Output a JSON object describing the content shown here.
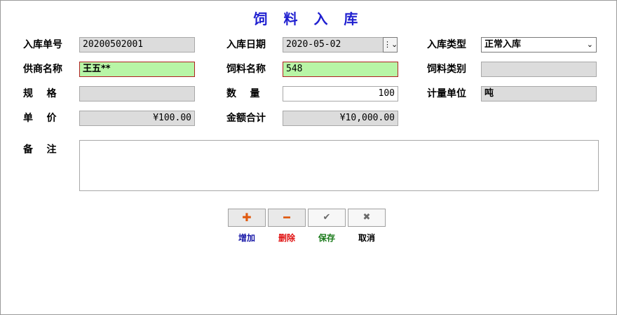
{
  "title": "饲 料 入 库",
  "fields": {
    "receipt_no": {
      "label": "入库单号",
      "value": "20200502001"
    },
    "receipt_date": {
      "label": "入库日期",
      "value": "2020-05-02"
    },
    "receipt_type": {
      "label": "入库类型",
      "value": "正常入库"
    },
    "supplier": {
      "label": "供商名称",
      "value": "王五**"
    },
    "feed_name": {
      "label": "饲料名称",
      "value": "548"
    },
    "feed_category": {
      "label": "饲料类别",
      "value": ""
    },
    "spec": {
      "label": "规    格",
      "value": ""
    },
    "quantity": {
      "label": "数    量",
      "value": "100"
    },
    "unit": {
      "label": "计量单位",
      "value": "吨"
    },
    "price": {
      "label": "单    价",
      "value": "¥100.00"
    },
    "amount": {
      "label": "金额合计",
      "value": "¥10,000.00"
    },
    "remark": {
      "label": "备    注",
      "value": ""
    }
  },
  "buttons": {
    "add": {
      "label": "增加",
      "icon": "plus-icon",
      "color": "#1a1aa8"
    },
    "delete": {
      "label": "删除",
      "icon": "minus-icon",
      "color": "#e01010"
    },
    "save": {
      "label": "保存",
      "icon": "check-icon",
      "color": "#1a7a1a"
    },
    "cancel": {
      "label": "取消",
      "icon": "x-icon",
      "color": "#000000"
    }
  },
  "colors": {
    "title": "#1f1fd0",
    "required_field_bg": "#b8f5a6",
    "readonly_field_bg": "#dcdcdc",
    "icon_orange": "#e05a10"
  }
}
